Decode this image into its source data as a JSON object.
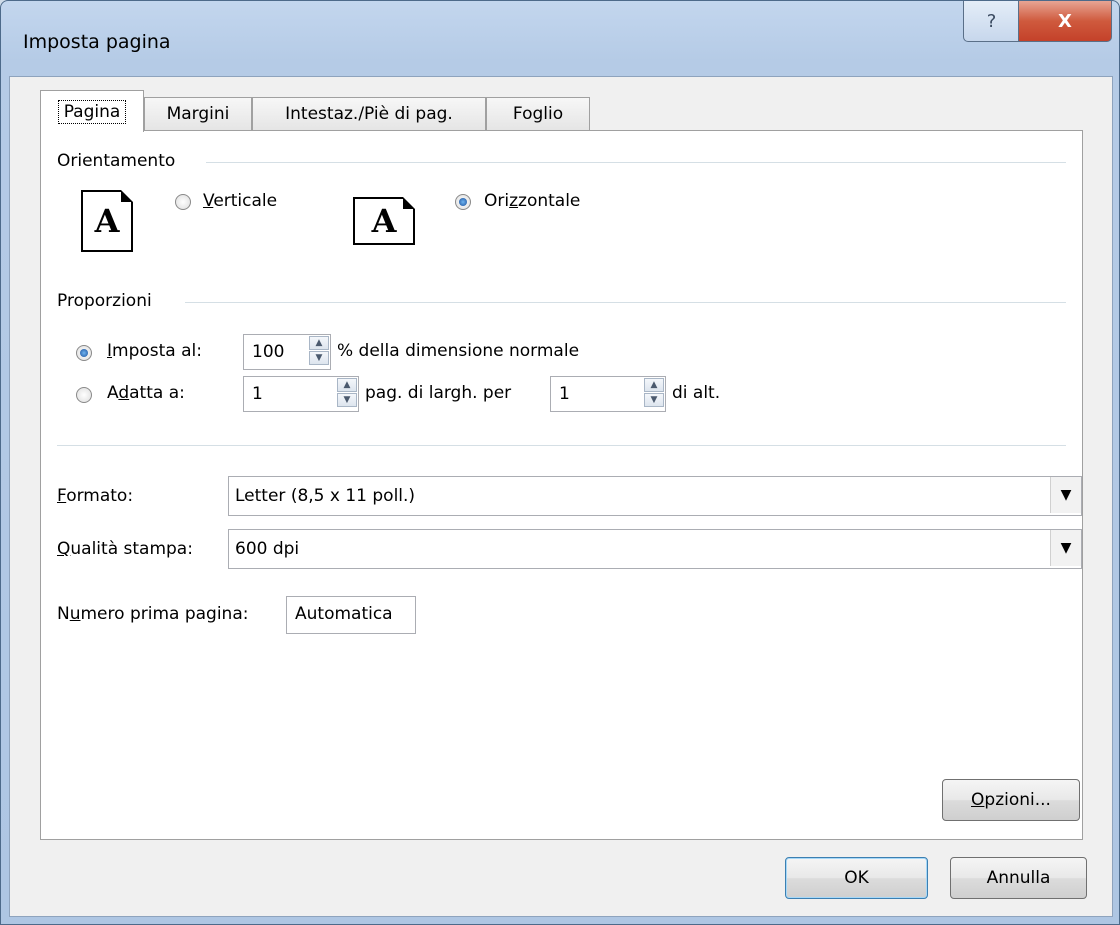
{
  "window": {
    "title": "Imposta pagina",
    "help_icon": "?",
    "close_icon": "X"
  },
  "tabs": [
    {
      "label": "Pagina",
      "active": true
    },
    {
      "label": "Margini",
      "active": false
    },
    {
      "label": "Intestaz./Piè di pag.",
      "active": false
    },
    {
      "label": "Foglio",
      "active": false
    }
  ],
  "orientation": {
    "group_label": "Orientamento",
    "portrait_letter": "A",
    "portrait_label_accel": "V",
    "portrait_label_rest": "erticale",
    "portrait_selected": false,
    "landscape_letter": "A",
    "landscape_label_pre": "Ori",
    "landscape_label_accel": "z",
    "landscape_label_rest": "zontale",
    "landscape_selected": true
  },
  "scaling": {
    "group_label": "Proporzioni",
    "adjust_label_accel": "I",
    "adjust_label_rest": "mposta al:",
    "adjust_selected": true,
    "adjust_value": "100",
    "adjust_suffix": "% della dimensione normale",
    "fit_label_pre": "A",
    "fit_label_accel": "d",
    "fit_label_rest": "atta a:",
    "fit_selected": false,
    "fit_wide_value": "1",
    "fit_middle": "pag. di largh. per",
    "fit_tall_value": "1",
    "fit_suffix": "di alt."
  },
  "paper": {
    "format_label_accel": "F",
    "format_label_rest": "ormato:",
    "format_value": "Letter (8,5 x 11 poll.)",
    "quality_label_accel": "Q",
    "quality_label_rest": "ualità stampa:",
    "quality_value": "600 dpi",
    "first_page_label_pre": "N",
    "first_page_label_accel": "u",
    "first_page_label_rest": "mero prima pagina:",
    "first_page_value": "Automatica"
  },
  "buttons": {
    "options_accel": "O",
    "options_rest": "pzioni...",
    "ok": "OK",
    "cancel": "Annulla"
  }
}
